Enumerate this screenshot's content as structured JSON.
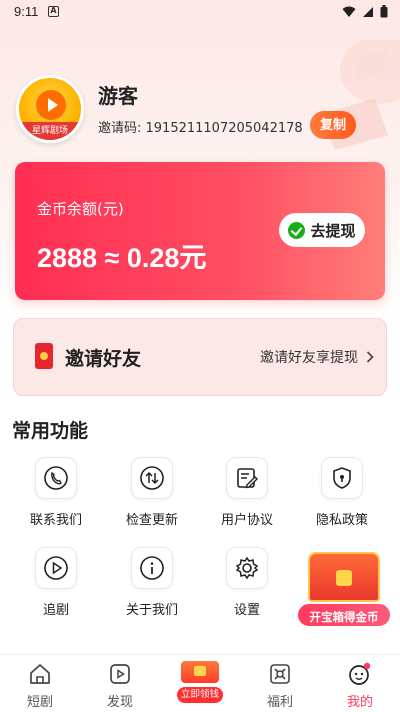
{
  "status_bar": {
    "time": "9:11",
    "notification_icon": "A"
  },
  "profile": {
    "avatar_text": "星辉剧场",
    "username": "游客",
    "invite_code_label": "邀请码: 1915211107205042178",
    "copy_label": "复制"
  },
  "balance": {
    "label": "金币余额(元)",
    "value": "2888 ≈ 0.28元",
    "withdraw_label": "去提现"
  },
  "invite": {
    "title": "邀请好友",
    "link_text": "邀请好友享提现"
  },
  "features": {
    "title": "常用功能",
    "items": [
      {
        "label": "联系我们",
        "icon": "phone-icon"
      },
      {
        "label": "检查更新",
        "icon": "update-icon"
      },
      {
        "label": "用户协议",
        "icon": "agreement-icon"
      },
      {
        "label": "隐私政策",
        "icon": "shield-icon"
      },
      {
        "label": "追剧",
        "icon": "play-icon"
      },
      {
        "label": "关于我们",
        "icon": "info-icon"
      },
      {
        "label": "设置",
        "icon": "gear-icon"
      }
    ]
  },
  "treasure": {
    "label": "开宝箱得金币"
  },
  "bottom_nav": {
    "items": [
      {
        "label": "短剧",
        "icon": "home-icon"
      },
      {
        "label": "发现",
        "icon": "discover-icon"
      },
      {
        "label": "立即领钱",
        "icon": "money-icon"
      },
      {
        "label": "福利",
        "icon": "welfare-icon"
      },
      {
        "label": "我的",
        "icon": "profile-icon",
        "active": true
      }
    ]
  },
  "colors": {
    "accent": "#ff3b5c",
    "copy_button": "#ff6a2c",
    "wechat_green": "#1aad19"
  }
}
